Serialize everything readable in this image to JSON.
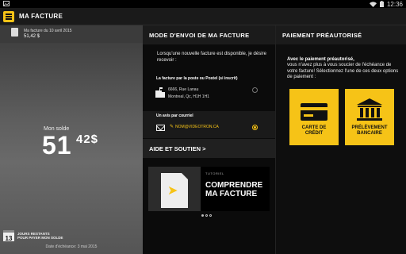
{
  "status_bar": {
    "time": "12:36",
    "wifi_icon": "wifi-icon",
    "battery_icon": "battery-icon"
  },
  "app_bar": {
    "title": "MA FACTURE",
    "menu_icon": "hamburger-menu-icon"
  },
  "invoice": {
    "label": "Ma facture du 10 avril 2015",
    "amount": "51,42 $"
  },
  "balance": {
    "label": "Mon solde",
    "dollars": "51",
    "cents": "42$"
  },
  "days_left": {
    "count": "13",
    "line1": "JOURS RESTANTS",
    "line2": "POUR PAYER MON SOLDE"
  },
  "due_date": "Date d'échéance: 3 mai 2015",
  "delivery": {
    "heading": "MODE D'ENVOI DE MA FACTURE",
    "intro": "Lorsqu'une nouvelle facture est disponible, je désire recevoir :",
    "postal_title": "La facture par la poste ou Postel (si inscrit)",
    "postal_line1": "6666, Rue Lanau",
    "postal_line2": "Montreal, Qc, H1H 1H1",
    "email_title": "Un avis par courriel",
    "email_value": "NOM@VIDEOTRON.CA",
    "selected": "email"
  },
  "help": {
    "heading": "AIDE ET SOUTIEN",
    "chevron": ">",
    "tutorial_tag": "TUTORIEL",
    "tutorial_title": "COMPRENDRE MA FACTURE",
    "pages": 3,
    "current_page": 1
  },
  "preauth": {
    "heading": "PAIEMENT PRÉAUTORISÉ",
    "bold": "Avec le paiement préautorisé,",
    "text": "vous n'avez plus à vous soucier de l'échéance de votre facture! Sélectionnez l'une de ces deux options de paiement :",
    "credit_label_1": "CARTE DE",
    "credit_label_2": "CRÉDIT",
    "bank_label_1": "PRÉLÈVEMENT",
    "bank_label_2": "BANCAIRE"
  },
  "colors": {
    "accent": "#f6c317",
    "background": "#0b0b0b"
  }
}
